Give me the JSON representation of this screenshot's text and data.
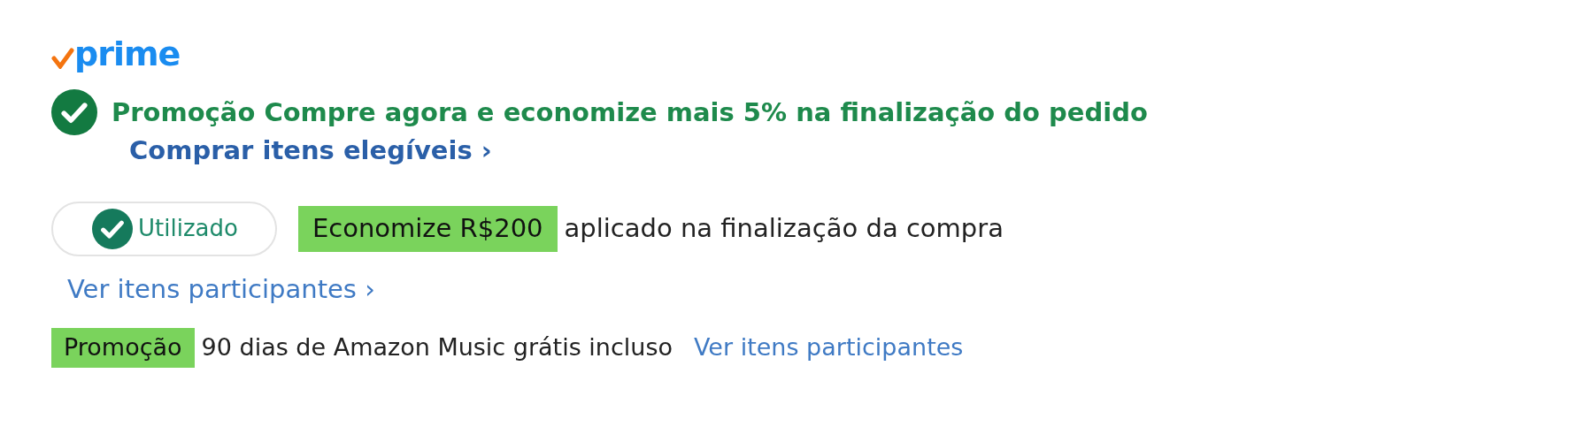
{
  "brand": {
    "label": "prime"
  },
  "promotion": {
    "text": "Promoção Compre agora e economize mais 5% na finalização do pedido",
    "link": "Comprar itens elegíveis ›"
  },
  "coupon": {
    "status": "Utilizado",
    "badge": "Economize R$200",
    "text": "aplicado na finalização da compra",
    "link": "Ver itens participantes ›"
  },
  "offer": {
    "badge": "Promoção",
    "text": "90 dias de Amazon Music grátis incluso",
    "link": "Ver itens participantes"
  }
}
